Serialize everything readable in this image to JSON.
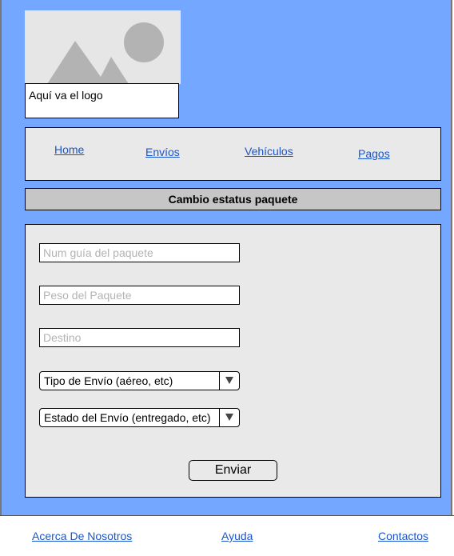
{
  "logo": {
    "caption": "Aquí va el logo",
    "icon": "image-placeholder-icon"
  },
  "nav": {
    "items": [
      {
        "label": "Home"
      },
      {
        "label": "Envíos"
      },
      {
        "label": "Vehículos"
      },
      {
        "label": "Pagos"
      }
    ]
  },
  "form": {
    "title": "Cambio estatus paquete",
    "guide_placeholder": "Num guía del paquete",
    "weight_placeholder": "Peso del Paquete",
    "destination_placeholder": "Destino",
    "shipping_type_selected": "Tipo de Envío (aéreo, etc)",
    "shipping_status_selected": "Estado del Envío (entregado, etc)",
    "submit_label": "Enviar"
  },
  "footer": {
    "links": [
      {
        "label": "Acerca De Nosotros"
      },
      {
        "label": "Ayuda"
      },
      {
        "label": "Contactos"
      }
    ]
  },
  "colors": {
    "background": "#74a7ff",
    "panel": "#e9e9e9",
    "title_bar": "#c6c6c6",
    "link": "#1a55cc"
  }
}
